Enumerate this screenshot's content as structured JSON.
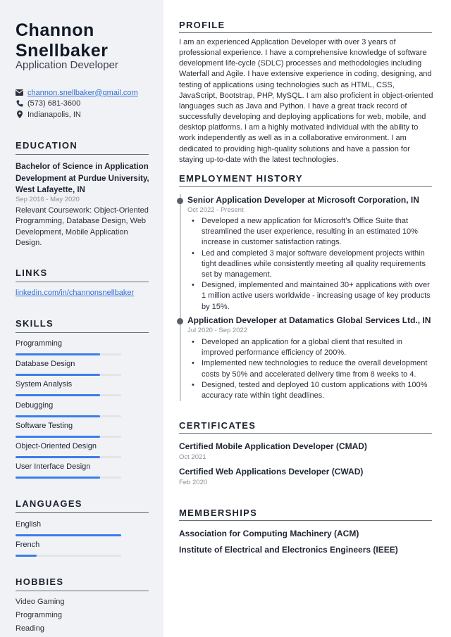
{
  "header": {
    "first_name": "Channon",
    "last_name": "Snellbaker",
    "job_title": "Application Developer"
  },
  "contact": {
    "email": "channon.snellbaker@gmail.com",
    "phone": "(573) 681-3600",
    "location": "Indianapolis, IN",
    "icons": {
      "email": "envelope-icon",
      "phone": "phone-icon",
      "location": "map-pin-icon"
    }
  },
  "education": {
    "heading": "EDUCATION",
    "degree": "Bachelor of Science in Application Development at Purdue University, West Lafayette, IN",
    "dates": "Sep 2016 - May 2020",
    "description": "Relevant Coursework: Object-Oriented Programming, Database Design, Web Development, Mobile Application Design."
  },
  "links": {
    "heading": "LINKS",
    "items": [
      "linkedin.com/in/channonsnellbaker"
    ]
  },
  "skills": {
    "heading": "SKILLS",
    "items": [
      {
        "label": "Programming",
        "level": 80
      },
      {
        "label": "Database Design",
        "level": 80
      },
      {
        "label": "System Analysis",
        "level": 80
      },
      {
        "label": "Debugging",
        "level": 80
      },
      {
        "label": "Software Testing",
        "level": 80
      },
      {
        "label": "Object-Oriented Design",
        "level": 80
      },
      {
        "label": "User Interface Design",
        "level": 80
      }
    ]
  },
  "languages": {
    "heading": "LANGUAGES",
    "items": [
      {
        "label": "English",
        "level": 100
      },
      {
        "label": "French",
        "level": 20
      }
    ]
  },
  "hobbies": {
    "heading": "HOBBIES",
    "items": [
      "Video Gaming",
      "Programming",
      "Reading"
    ]
  },
  "profile": {
    "heading": "PROFILE",
    "text": "I am an experienced Application Developer with over 3 years of professional experience. I have a comprehensive knowledge of software development life-cycle (SDLC) processes and methodologies including Waterfall and Agile. I have extensive experience in coding, designing, and testing of applications using technologies such as HTML, CSS, JavaScript, Bootstrap, PHP, MySQL. I am also proficient in object-oriented languages such as Java and Python. I have a great track record of successfully developing and deploying applications for web, mobile, and desktop platforms. I am a highly motivated individual with the ability to work independently as well as in a collaborative environment. I am dedicated to providing high-quality solutions and have a passion for staying up-to-date with the latest technologies."
  },
  "employment": {
    "heading": "EMPLOYMENT HISTORY",
    "jobs": [
      {
        "title": "Senior Application Developer at Microsoft Corporation, IN",
        "dates": "Oct 2022 - Present",
        "bullets": [
          "Developed a new application for Microsoft’s Office Suite that streamlined the user experience, resulting in an estimated 10% increase in customer satisfaction ratings.",
          "Led and completed 3 major software development projects within tight deadlines while consistently meeting all quality requirements set by management.",
          "Designed, implemented and maintained 30+ applications with over 1 million active users worldwide - increasing usage of key products by 15%."
        ]
      },
      {
        "title": "Application Developer at Datamatics Global Services Ltd., IN",
        "dates": "Jul 2020 - Sep 2022",
        "bullets": [
          "Developed an application for a global client that resulted in improved performance efficiency of 200%.",
          "Implemented new technologies to reduce the overall development costs by 50% and accelerated delivery time from 8 weeks to 4.",
          "Designed, tested and deployed 10 custom applications with 100% accuracy rate within tight deadlines."
        ]
      }
    ]
  },
  "certificates": {
    "heading": "CERTIFICATES",
    "items": [
      {
        "title": "Certified Mobile Application Developer (CMAD)",
        "date": "Oct 2021"
      },
      {
        "title": "Certified Web Applications Developer (CWAD)",
        "date": "Feb 2020"
      }
    ]
  },
  "memberships": {
    "heading": "MEMBERSHIPS",
    "items": [
      "Association for Computing Machinery (ACM)",
      "Institute of Electrical and Electronics Engineers (IEEE)"
    ]
  },
  "colors": {
    "sidebar_bg": "#f1f2f5",
    "accent": "#3b7de9",
    "link": "#2f6fd6",
    "heading": "#1c2230"
  }
}
